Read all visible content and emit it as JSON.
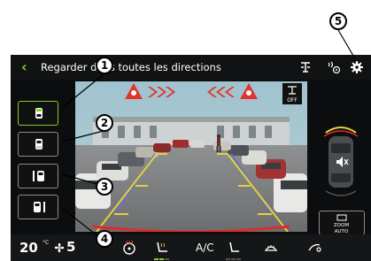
{
  "header": {
    "title": "Regarder dans toutes les directions"
  },
  "views": [
    {
      "id": "front",
      "active": true
    },
    {
      "id": "rear",
      "active": false
    },
    {
      "id": "left",
      "active": false
    },
    {
      "id": "right",
      "active": false
    }
  ],
  "camera": {
    "off_label": "OFF"
  },
  "zoom": {
    "line1": "ZOOM",
    "line2": "AUTO"
  },
  "climate": {
    "temperature": "20",
    "temperature_unit": "°C",
    "fan_speed": "5",
    "ac_label": "A/C"
  },
  "callouts": [
    "1",
    "2",
    "3",
    "4",
    "5"
  ],
  "colors": {
    "accent": "#7ed321",
    "warning": "#e0342c",
    "background": "#0c0d0e"
  }
}
